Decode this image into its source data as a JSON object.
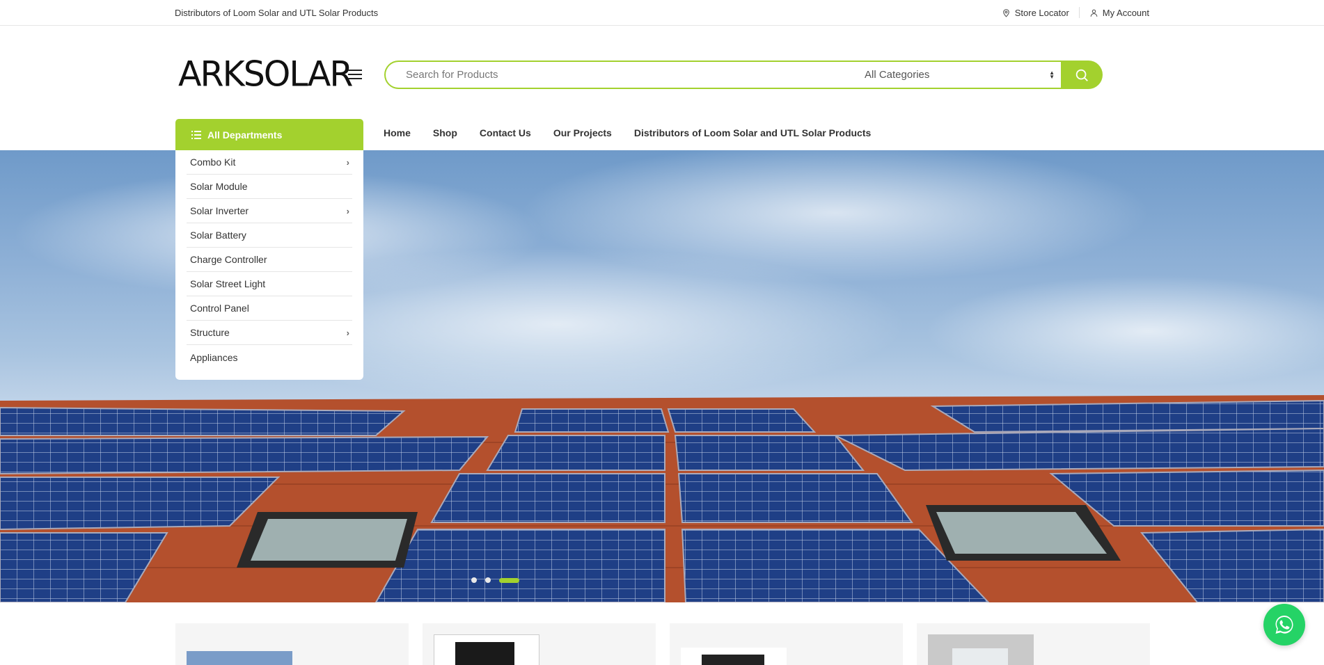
{
  "topbar": {
    "tagline": "Distributors of Loom Solar and UTL Solar Products",
    "store_locator": "Store Locator",
    "my_account": "My Account"
  },
  "header": {
    "logo": "ARKSOLAR",
    "search_placeholder": "Search for Products",
    "category_selected": "All Categories"
  },
  "nav": {
    "departments_label": "All Departments",
    "links": [
      "Home",
      "Shop",
      "Contact Us",
      "Our Projects",
      "Distributors of Loom Solar and UTL Solar Products"
    ]
  },
  "departments": [
    {
      "label": "Combo Kit",
      "has_sub": true
    },
    {
      "label": "Solar Module",
      "has_sub": false
    },
    {
      "label": "Solar Inverter",
      "has_sub": true
    },
    {
      "label": "Solar Battery",
      "has_sub": false
    },
    {
      "label": "Charge Controller",
      "has_sub": false
    },
    {
      "label": "Solar Street Light",
      "has_sub": false
    },
    {
      "label": "Control Panel",
      "has_sub": false
    },
    {
      "label": "Structure",
      "has_sub": true
    },
    {
      "label": "Appliances",
      "has_sub": false
    }
  ],
  "slider": {
    "slide_count": 3,
    "active_slide": 3
  },
  "colors": {
    "accent": "#a3d12e",
    "whatsapp": "#25d366"
  }
}
